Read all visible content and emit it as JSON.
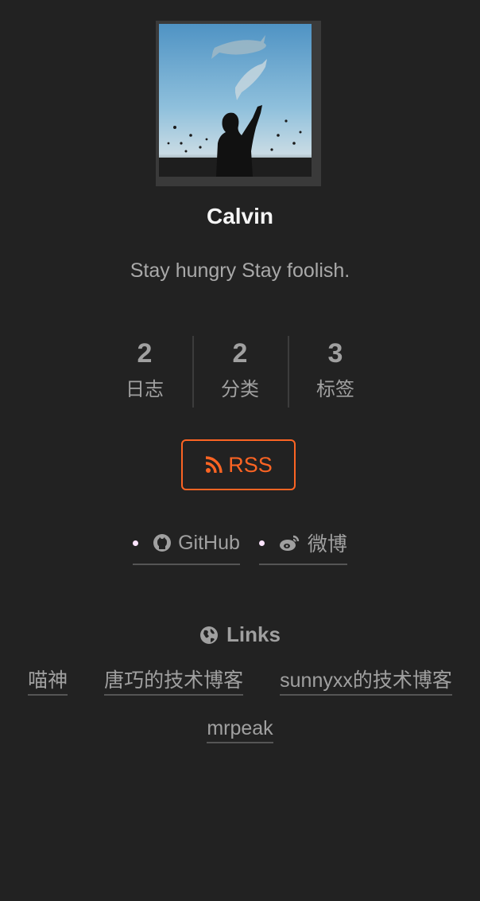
{
  "author": {
    "name": "Calvin",
    "description": "Stay hungry Stay foolish."
  },
  "stats": [
    {
      "count": "2",
      "label": "日志"
    },
    {
      "count": "2",
      "label": "分类"
    },
    {
      "count": "3",
      "label": "标签"
    }
  ],
  "rss": {
    "label": "RSS",
    "icon": "rss-icon",
    "color": "#fc6423"
  },
  "social": [
    {
      "label": "GitHub",
      "icon": "github-icon"
    },
    {
      "label": "微博",
      "icon": "weibo-icon"
    }
  ],
  "links": {
    "title": "Links",
    "icon": "globe-icon",
    "items": [
      "喵神",
      "唐巧的技术博客",
      "sunnyxx的技术博客",
      "mrpeak"
    ]
  },
  "colors": {
    "background": "#222222",
    "text": "#999999",
    "accent": "#fc6423"
  }
}
